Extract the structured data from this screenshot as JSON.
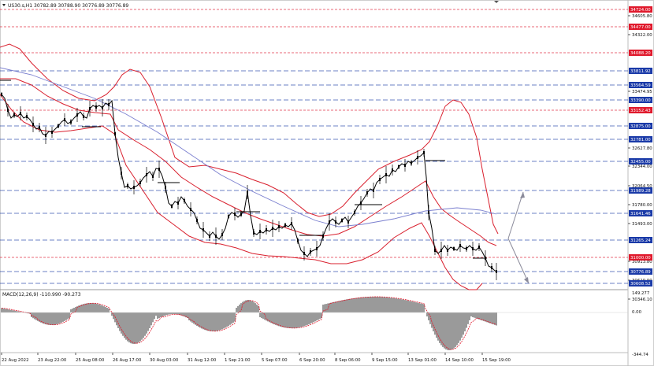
{
  "header": {
    "symbol_line": "US30.s,H1  30782.89 30788.90 30776.89 30776.89"
  },
  "indicator": {
    "label": "MACD(12,26,9) -110.990 -90.273"
  },
  "price_axis": {
    "labels": [
      "34605.80",
      "34322.00",
      "33474.95",
      "32627.80",
      "32344.00",
      "32064.50",
      "31780.00",
      "31493.00",
      "30913.80",
      "30629.90",
      "30346.10"
    ]
  },
  "price_tags": [
    {
      "text": "34724.00",
      "color": "#e0192c"
    },
    {
      "text": "34477.00",
      "color": "#e0192c"
    },
    {
      "text": "34088.20",
      "color": "#e0192c"
    },
    {
      "text": "33811.92",
      "color": "#1a3aa8"
    },
    {
      "text": "33564.59",
      "color": "#1a3aa8"
    },
    {
      "text": "33390.00",
      "color": "#1a3aa8"
    },
    {
      "text": "33152.43",
      "color": "#e0192c"
    },
    {
      "text": "32875.00",
      "color": "#1a3aa8"
    },
    {
      "text": "32781.00",
      "color": "#1a3aa8"
    },
    {
      "text": "32455.00",
      "color": "#1a3aa8"
    },
    {
      "text": "31989.28",
      "color": "#1a3aa8"
    },
    {
      "text": "31641.46",
      "color": "#1a3aa8"
    },
    {
      "text": "31265.24",
      "color": "#1a3aa8"
    },
    {
      "text": "31000.00",
      "color": "#e0192c"
    },
    {
      "text": "30776.89",
      "color": "#1a3aa8"
    },
    {
      "text": "30608.52",
      "color": "#1a3aa8"
    }
  ],
  "macd_axis": {
    "labels": [
      "149.277",
      "0.00",
      "-344.74"
    ]
  },
  "time_axis": {
    "labels": [
      "22 Aug 2022",
      "23 Aug 22:00",
      "25 Aug 08:00",
      "26 Aug 17:00",
      "30 Aug 03:00",
      "31 Aug 12:00",
      "1 Sep 21:00",
      "5 Sep 07:00",
      "6 Sep 20:00",
      "8 Sep 06:00",
      "9 Sep 15:00",
      "13 Sep 01:00",
      "14 Sep 10:00",
      "15 Sep 19:00"
    ]
  },
  "colors": {
    "bollinger": "#d9202e",
    "moving_average": "#7a7fcf",
    "candles": "#000000",
    "arrows": "#8a8a9a",
    "macd_hist": "#9a9a9a",
    "macd_signal": "#e0192c"
  }
}
